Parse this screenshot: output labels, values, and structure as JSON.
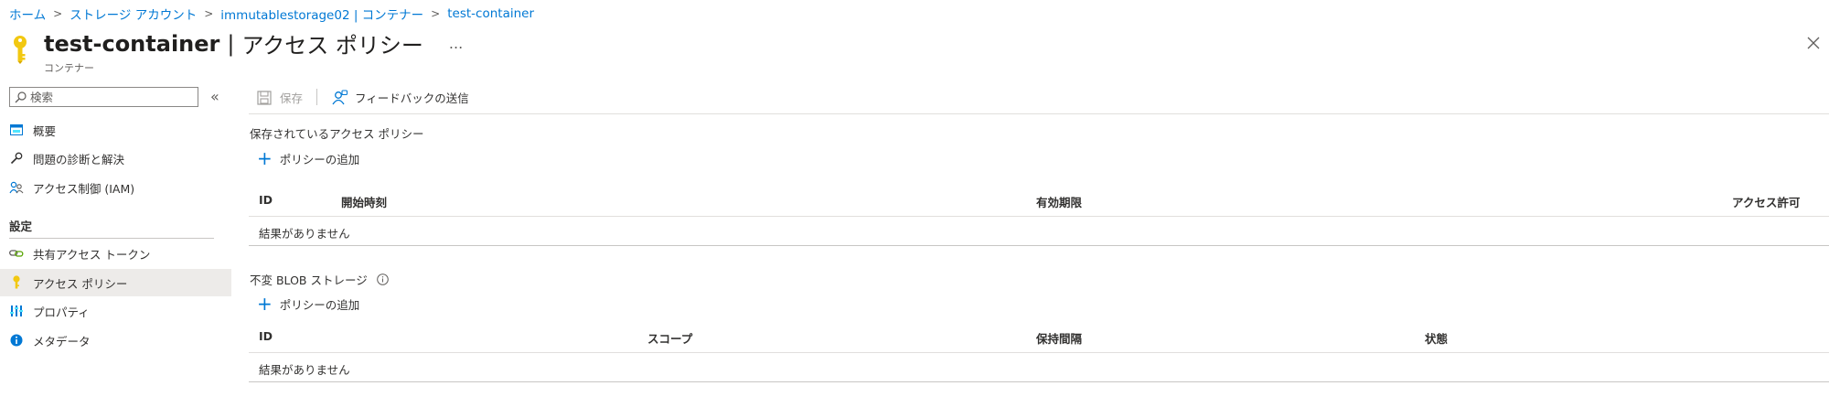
{
  "breadcrumb": {
    "home": "ホーム",
    "storage_accounts": "ストレージ アカウント",
    "account": "immutablestorage02 | コンテナー",
    "current": "test-container"
  },
  "header": {
    "title_name": "test-container",
    "title_separator": "|",
    "title_page": "アクセス ポリシー",
    "more": "...",
    "subtitle": "コンテナー",
    "icon": "key-icon",
    "accent_color": "#f2c811"
  },
  "sidebar": {
    "search_placeholder": "検索",
    "collapse_glyph": "«",
    "items": [
      {
        "label": "概要",
        "icon": "overview-icon"
      },
      {
        "label": "問題の診断と解決",
        "icon": "wrench-icon"
      },
      {
        "label": "アクセス制御 (IAM)",
        "icon": "people-icon"
      }
    ],
    "settings_label": "設定",
    "settings_items": [
      {
        "label": "共有アクセス トークン",
        "icon": "link-icon"
      },
      {
        "label": "アクセス ポリシー",
        "icon": "key-icon",
        "selected": true
      },
      {
        "label": "プロパティ",
        "icon": "properties-icon"
      },
      {
        "label": "メタデータ",
        "icon": "info-icon"
      }
    ]
  },
  "toolbar": {
    "save_label": "保存",
    "feedback_label": "フィードバックの送信"
  },
  "stored_policies": {
    "title": "保存されているアクセス ポリシー",
    "add_label": "ポリシーの追加",
    "columns": [
      "ID",
      "開始時刻",
      "有効期限",
      "アクセス許可"
    ],
    "empty": "結果がありません"
  },
  "immutable_storage": {
    "title": "不変 BLOB ストレージ",
    "add_label": "ポリシーの追加",
    "columns": [
      "ID",
      "スコープ",
      "保持間隔",
      "状態"
    ],
    "empty": "結果がありません"
  },
  "colors": {
    "link": "#0078d4",
    "selected_bg": "#edebe9",
    "key": "#f2c811"
  }
}
